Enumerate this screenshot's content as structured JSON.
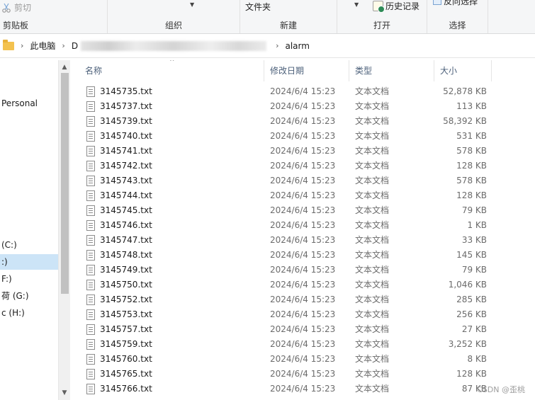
{
  "ribbon": {
    "cut_label": "剪切",
    "clipboard_group": "剪贴板",
    "organize_group": "组织",
    "new_group": "新建",
    "new_folder_label": "文件夹",
    "open_group": "打开",
    "history_label": "历史记录",
    "select_group": "选择",
    "invert_select_label": "反向选择"
  },
  "address": {
    "crumbs": [
      "此电脑",
      "D",
      "alarm"
    ]
  },
  "nav": {
    "items": [
      {
        "label": "Personal",
        "selected": false
      },
      {
        "label": " (C:)",
        "selected": false
      },
      {
        "label": ":)",
        "selected": true
      },
      {
        "label": "F:)",
        "selected": false
      },
      {
        "label": "荷 (G:)",
        "selected": false
      },
      {
        "label": "c (H:)",
        "selected": false
      }
    ]
  },
  "columns": {
    "name": "名称",
    "date": "修改日期",
    "type": "类型",
    "size": "大小"
  },
  "files": [
    {
      "name": "3145735.txt",
      "date": "2024/6/4 15:23",
      "type": "文本文档",
      "size": "52,878 KB"
    },
    {
      "name": "3145737.txt",
      "date": "2024/6/4 15:23",
      "type": "文本文档",
      "size": "113 KB"
    },
    {
      "name": "3145739.txt",
      "date": "2024/6/4 15:23",
      "type": "文本文档",
      "size": "58,392 KB"
    },
    {
      "name": "3145740.txt",
      "date": "2024/6/4 15:23",
      "type": "文本文档",
      "size": "531 KB"
    },
    {
      "name": "3145741.txt",
      "date": "2024/6/4 15:23",
      "type": "文本文档",
      "size": "578 KB"
    },
    {
      "name": "3145742.txt",
      "date": "2024/6/4 15:23",
      "type": "文本文档",
      "size": "128 KB"
    },
    {
      "name": "3145743.txt",
      "date": "2024/6/4 15:23",
      "type": "文本文档",
      "size": "578 KB"
    },
    {
      "name": "3145744.txt",
      "date": "2024/6/4 15:23",
      "type": "文本文档",
      "size": "128 KB"
    },
    {
      "name": "3145745.txt",
      "date": "2024/6/4 15:23",
      "type": "文本文档",
      "size": "79 KB"
    },
    {
      "name": "3145746.txt",
      "date": "2024/6/4 15:23",
      "type": "文本文档",
      "size": "1 KB"
    },
    {
      "name": "3145747.txt",
      "date": "2024/6/4 15:23",
      "type": "文本文档",
      "size": "33 KB"
    },
    {
      "name": "3145748.txt",
      "date": "2024/6/4 15:23",
      "type": "文本文档",
      "size": "145 KB"
    },
    {
      "name": "3145749.txt",
      "date": "2024/6/4 15:23",
      "type": "文本文档",
      "size": "79 KB"
    },
    {
      "name": "3145750.txt",
      "date": "2024/6/4 15:23",
      "type": "文本文档",
      "size": "1,046 KB"
    },
    {
      "name": "3145752.txt",
      "date": "2024/6/4 15:23",
      "type": "文本文档",
      "size": "285 KB"
    },
    {
      "name": "3145753.txt",
      "date": "2024/6/4 15:23",
      "type": "文本文档",
      "size": "256 KB"
    },
    {
      "name": "3145757.txt",
      "date": "2024/6/4 15:23",
      "type": "文本文档",
      "size": "27 KB"
    },
    {
      "name": "3145759.txt",
      "date": "2024/6/4 15:23",
      "type": "文本文档",
      "size": "3,252 KB"
    },
    {
      "name": "3145760.txt",
      "date": "2024/6/4 15:23",
      "type": "文本文档",
      "size": "8 KB"
    },
    {
      "name": "3145765.txt",
      "date": "2024/6/4 15:23",
      "type": "文本文档",
      "size": "128 KB"
    },
    {
      "name": "3145766.txt",
      "date": "2024/6/4 15:23",
      "type": "文本文档",
      "size": "87 KB"
    }
  ],
  "watermark": "CSDN @歪桃"
}
